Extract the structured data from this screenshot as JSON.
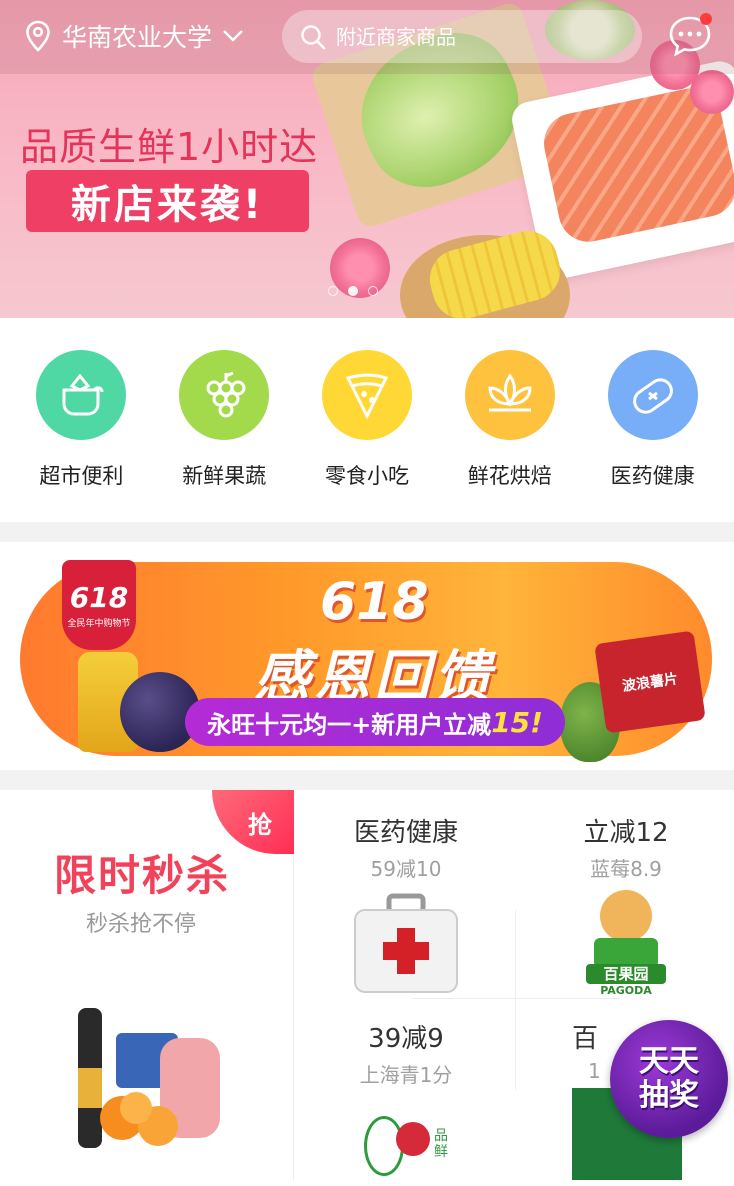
{
  "header": {
    "location": "华南农业大学",
    "search_placeholder": "附近商家商品"
  },
  "banner": {
    "slogan": "品质生鲜1小时达",
    "cta": "新店来袭!",
    "pages": 3,
    "active_page": 1
  },
  "categories": [
    {
      "label": "超市便利",
      "icon": "shop-bird-icon",
      "color": "#4fd8a4"
    },
    {
      "label": "新鲜果蔬",
      "icon": "grape-icon",
      "color": "#a3da4c"
    },
    {
      "label": "零食小吃",
      "icon": "pizza-icon",
      "color": "#ffd835"
    },
    {
      "label": "鲜花烘焙",
      "icon": "lotus-icon",
      "color": "#ffc23e"
    },
    {
      "label": "医药健康",
      "icon": "bandage-icon",
      "color": "#77aef7"
    }
  ],
  "promo": {
    "badge": "618",
    "badge_sub": "全民年中购物节",
    "headline_1": "618",
    "headline_2": "感恩回馈",
    "ribbon_text": "永旺十元均一+新用户立减",
    "ribbon_num": "15!",
    "chips_label": "波浪薯片"
  },
  "flash_sale": {
    "tag": "抢",
    "title": "限时秒杀",
    "subtitle": "秒杀抢不停",
    "cells": [
      {
        "title": "医药健康",
        "sub": "59减10"
      },
      {
        "title": "立减12",
        "sub": "蓝莓8.9"
      },
      {
        "title": "39减9",
        "sub": "上海青1分"
      },
      {
        "title": "百",
        "sub": "1"
      }
    ],
    "brand": "百果园",
    "brand_en": "PAGODA",
    "fresh_label": "品鲜"
  },
  "lottery": {
    "line1": "天天",
    "line2": "抽奖"
  }
}
